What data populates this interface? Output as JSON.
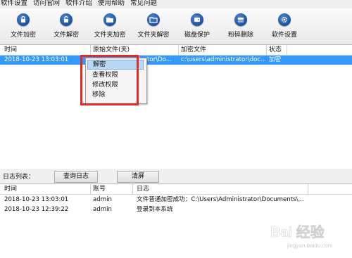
{
  "menubar": {
    "items": [
      "软件设置",
      "访问官网",
      "软件介绍",
      "使用帮助",
      "常见问题"
    ]
  },
  "toolbar": {
    "buttons": [
      {
        "label": "文件加密",
        "icon": "lock-icon"
      },
      {
        "label": "文件解密",
        "icon": "unlock-icon"
      },
      {
        "label": "文件夹加密",
        "icon": "folder-lock-icon"
      },
      {
        "label": "文件夹解密",
        "icon": "folder-unlock-icon"
      },
      {
        "label": "磁盘保护",
        "icon": "disk-icon"
      },
      {
        "label": "粉碎删除",
        "icon": "shred-icon"
      },
      {
        "label": "软件设置",
        "icon": "gear-icon"
      }
    ]
  },
  "files_table": {
    "headers": [
      "时间",
      "原始文件(夹)",
      "加密文件",
      "状态"
    ],
    "rows": [
      {
        "time": "2018-10-23 13:03:01",
        "original": "istrator\\Do...",
        "encrypted": "c:\\users\\administrator\\doc...",
        "status": "加密"
      }
    ]
  },
  "context_menu": {
    "items": [
      "解密",
      "查看权限",
      "修改权限",
      "移除"
    ]
  },
  "log_bar": {
    "label": "日志列表：",
    "query_button": "查询日志",
    "clear_button": "清屏"
  },
  "log_table": {
    "headers": [
      "时间",
      "账号",
      "日志"
    ],
    "rows": [
      {
        "time": "2018-10-23 13:03:01",
        "account": "admin",
        "log": "文件普通加密成功：C:\\Users\\Administrator\\Documents\\..."
      },
      {
        "time": "2018-10-23 12:39:22",
        "account": "admin",
        "log": "登录到本系统"
      }
    ]
  },
  "watermark": {
    "text": "Bai 经验",
    "sub": "jingyan.baidu.com"
  },
  "colors": {
    "selection": "#3399ff",
    "highlight_outline": "#e02a2a",
    "icon_blue": "#1c4f9c"
  }
}
